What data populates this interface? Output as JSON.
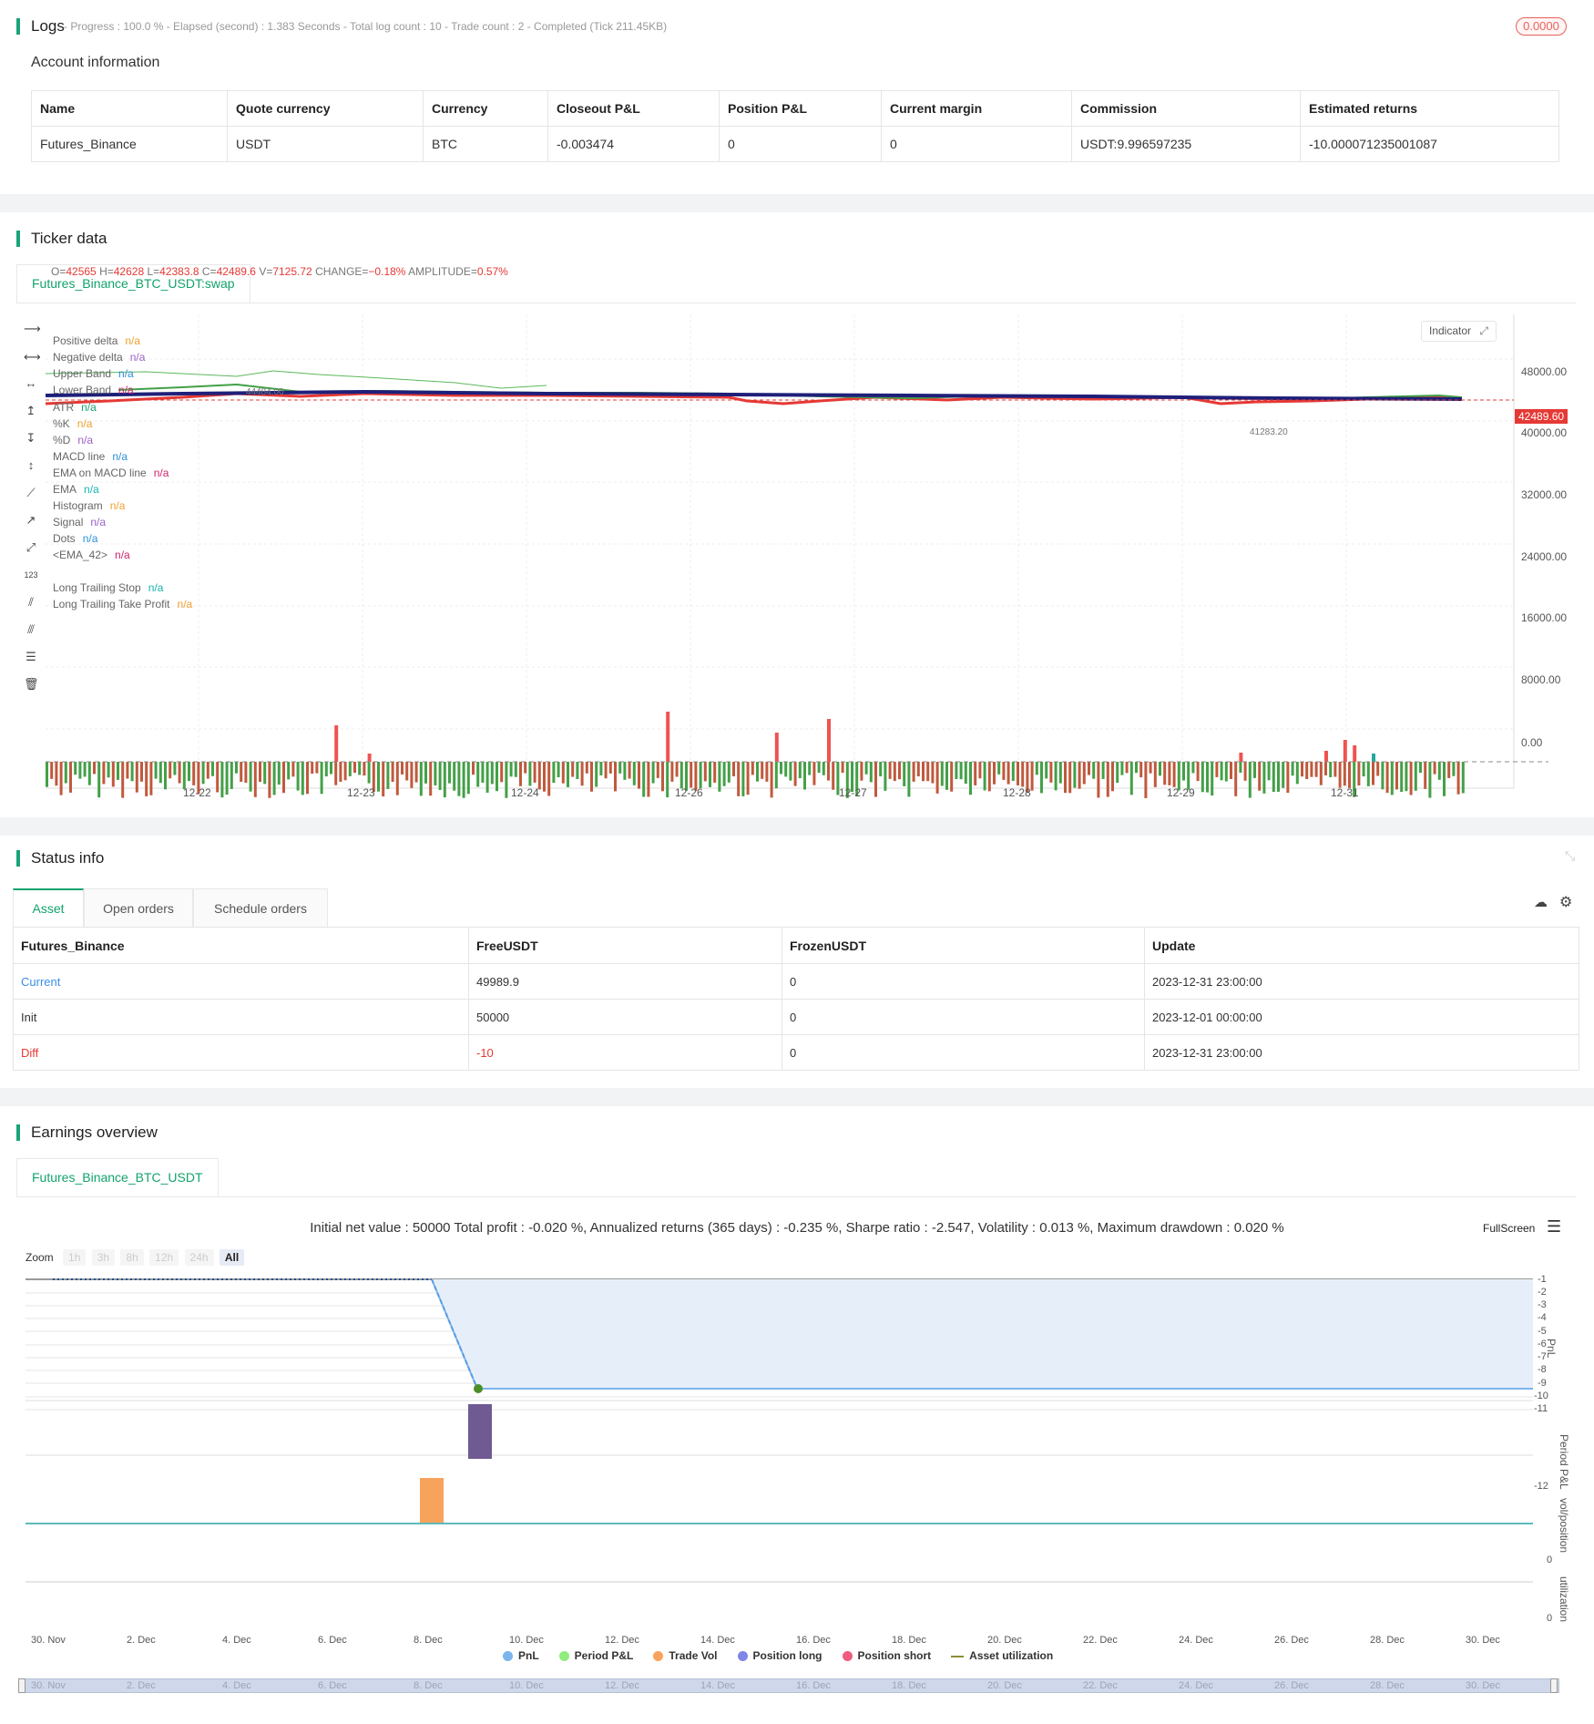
{
  "logs": {
    "title": "Logs",
    "progress_text": "- Progress : 100.0 % - Elapsed (second) : 1.383  Seconds - Total log count : 10 - Trade count : 2 - Completed (Tick 211.45KB)",
    "badge": "0.0000"
  },
  "account": {
    "title": "Account information",
    "headers": [
      "Name",
      "Quote currency",
      "Currency",
      "Closeout P&L",
      "Position P&L",
      "Current margin",
      "Commission",
      "Estimated returns"
    ],
    "row": [
      "Futures_Binance",
      "USDT",
      "BTC",
      "-0.003474",
      "0",
      "0",
      "USDT:9.996597235",
      "-10.000071235001087"
    ]
  },
  "ticker": {
    "title": "Ticker data",
    "tab": "Futures_Binance_BTC_USDT:swap",
    "ohlc": {
      "o_label": "O=",
      "o": "42565",
      "h_label": "H=",
      "h": "42628",
      "l_label": "L=",
      "l": "42383.8",
      "c_label": "C=",
      "c": "42489.6",
      "v_label": "V=",
      "v": "7125.72",
      "chg_label": "CHANGE=",
      "chg": "−0.18%",
      "amp_label": "AMPLITUDE=",
      "amp": "0.57%"
    },
    "indicator_btn": "Indicator",
    "legend": [
      {
        "name": "Positive delta",
        "value": "n/a",
        "color": "#f0a030"
      },
      {
        "name": "Negative delta",
        "value": "n/a",
        "color": "#9c5fc8"
      },
      {
        "name": "Upper Band",
        "value": "n/a",
        "color": "#2b90d9"
      },
      {
        "name": "Lower Band",
        "value": "n/a",
        "color": "#d0246c"
      },
      {
        "name": "ATR",
        "value": "n/a",
        "color": "#1aa37a"
      },
      {
        "name": "%K",
        "value": "n/a",
        "color": "#f0a030"
      },
      {
        "name": "%D",
        "value": "n/a",
        "color": "#9c5fc8"
      },
      {
        "name": "MACD line",
        "value": "n/a",
        "color": "#2b90d9"
      },
      {
        "name": "EMA on MACD line",
        "value": "n/a",
        "color": "#d0246c"
      },
      {
        "name": "EMA",
        "value": "n/a",
        "color": "#1ab3b3"
      },
      {
        "name": "Histogram",
        "value": "n/a",
        "color": "#f0a030"
      },
      {
        "name": "Signal",
        "value": "n/a",
        "color": "#9c5fc8"
      },
      {
        "name": "Dots",
        "value": "n/a",
        "color": "#2b90d9"
      },
      {
        "name": "<EMA_42>",
        "value": "n/a",
        "color": "#d0246c"
      },
      {
        "name": "Long Trailing Stop",
        "value": "n/a",
        "color": "#1ab3b3"
      },
      {
        "name": "Long Trailing Take Profit",
        "value": "n/a",
        "color": "#f0a030"
      }
    ],
    "y_ticks": [
      "48000.00",
      "40000.00",
      "32000.00",
      "24000.00",
      "16000.00",
      "8000.00",
      "0.00"
    ],
    "x_ticks": [
      "12-22",
      "12-23",
      "12-24",
      "12-26",
      "12-27",
      "12-28",
      "12-29",
      "12-31"
    ],
    "price_tag": "42489.60",
    "high_mark": "44484.00",
    "low_mark": "41283.20"
  },
  "status": {
    "title": "Status info",
    "tabs": [
      "Asset",
      "Open orders",
      "Schedule orders"
    ],
    "headers": [
      "Futures_Binance",
      "FreeUSDT",
      "FrozenUSDT",
      "Update"
    ],
    "rows": [
      [
        "Current",
        "49989.9",
        "0",
        "2023-12-31 23:00:00"
      ],
      [
        "Init",
        "50000",
        "0",
        "2023-12-01 00:00:00"
      ],
      [
        "Diff",
        "-10",
        "0",
        "2023-12-31 23:00:00"
      ]
    ]
  },
  "earnings": {
    "title": "Earnings overview",
    "tab": "Futures_Binance_BTC_USDT",
    "summary": "Initial net value : 50000 Total profit : -0.020 %, Annualized returns (365 days) : -0.235 %, Sharpe ratio : -2.547, Volatility : 0.013 %, Maximum drawdown : 0.020 %",
    "fullscreen": "FullScreen",
    "zoom_label": "Zoom",
    "zoom_options": [
      "1h",
      "3h",
      "8h",
      "12h",
      "24h",
      "All"
    ],
    "pnl_ticks": [
      "-1",
      "-2",
      "-3",
      "-4",
      "-5",
      "-6",
      "-7",
      "-8",
      "-9",
      "-10",
      "-11"
    ],
    "pane_labels": [
      "PnL",
      "Period P&L",
      "vol/position",
      "utilization"
    ],
    "period_tick": "-12",
    "vol_tick": "0",
    "util_tick": "0",
    "x_ticks": [
      "30. Nov",
      "2. Dec",
      "4. Dec",
      "6. Dec",
      "8. Dec",
      "10. Dec",
      "12. Dec",
      "14. Dec",
      "16. Dec",
      "18. Dec",
      "20. Dec",
      "22. Dec",
      "24. Dec",
      "26. Dec",
      "28. Dec",
      "30. Dec"
    ],
    "legend": [
      {
        "name": "PnL",
        "color": "#7cb5ec"
      },
      {
        "name": "Period P&L",
        "color": "#90ed7d"
      },
      {
        "name": "Trade Vol",
        "color": "#f7a35c"
      },
      {
        "name": "Position long",
        "color": "#8085e9"
      },
      {
        "name": "Position short",
        "color": "#f15c80"
      },
      {
        "name": "Asset utilization",
        "color": "#8d8d3a"
      }
    ]
  }
}
